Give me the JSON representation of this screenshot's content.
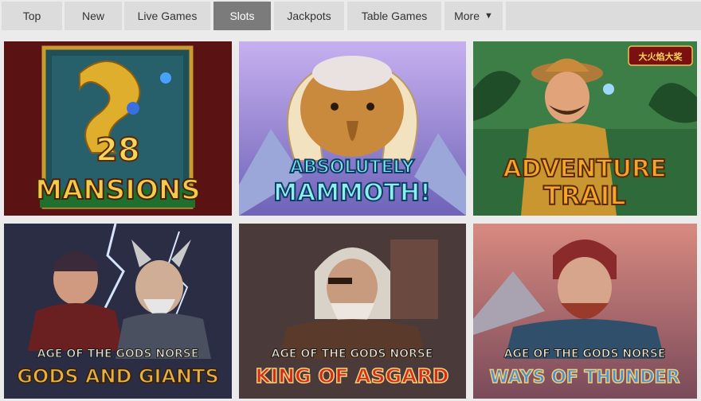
{
  "tabs": [
    {
      "label": "Top",
      "active": false
    },
    {
      "label": "New",
      "active": false
    },
    {
      "label": "Live Games",
      "active": false
    },
    {
      "label": "Slots",
      "active": true
    },
    {
      "label": "Jackpots",
      "active": false
    },
    {
      "label": "Table Games",
      "active": false
    },
    {
      "label": "More",
      "active": false
    }
  ],
  "more_icon": "caret-down-icon",
  "games": [
    {
      "line1": "28",
      "line2": "MANSIONS",
      "colors": {
        "bg": "#5a1212",
        "accent": "#e7b530",
        "text": "#f4d05a"
      }
    },
    {
      "line1": "ABSOLUTELY",
      "line2": "MAMMOTH!",
      "colors": {
        "bg": "#8f77c8",
        "accent": "#c88a3a",
        "text": "#7fe4e0"
      }
    },
    {
      "line1": "ADVENTURE",
      "line2": "TRAIL",
      "badge": "大火焰大奖",
      "colors": {
        "bg": "#2f6a3a",
        "accent": "#c98b2f",
        "text": "#f3a629"
      }
    },
    {
      "line1": "AGE OF THE GODS NORSE",
      "line2": "GODS AND GIANTS",
      "colors": {
        "bg": "#2b2d44",
        "accent": "#d9c36e",
        "text": "#e3b245"
      }
    },
    {
      "line1": "AGE OF THE GODS NORSE",
      "line2": "KING OF ASGARD",
      "colors": {
        "bg": "#4a3a3a",
        "accent": "#d9d2c8",
        "text": "#d62b1f"
      }
    },
    {
      "line1": "AGE OF THE GODS NORSE",
      "line2": "WAYS OF THUNDER",
      "colors": {
        "bg": "#9b5a5e",
        "accent": "#5f8fb0",
        "text": "#4a8fd8"
      }
    }
  ]
}
